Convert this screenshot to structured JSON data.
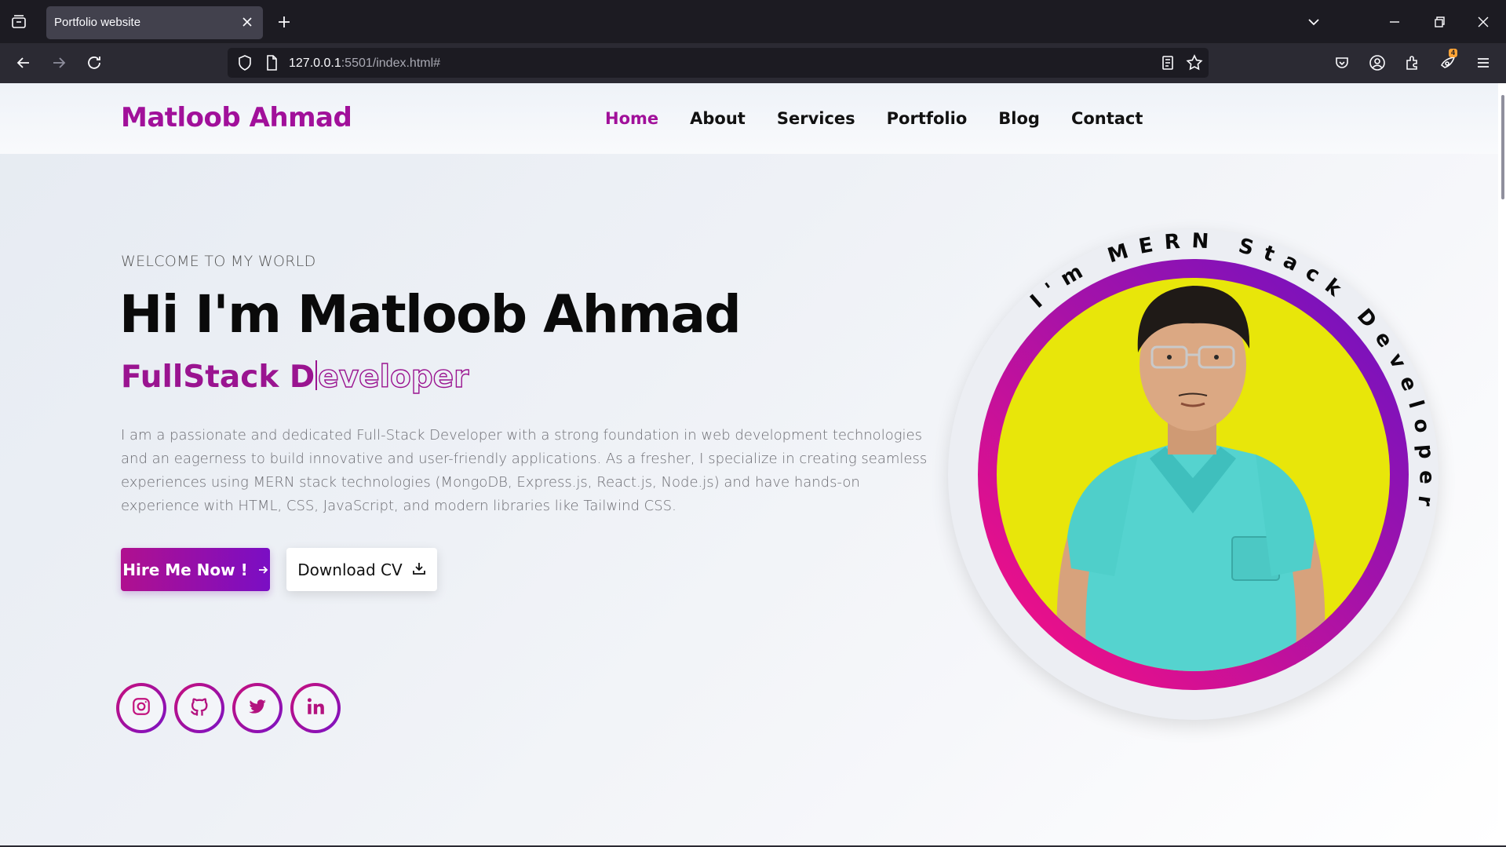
{
  "browser": {
    "tab_title": "Portfolio website",
    "url_host": "127.0.0.1",
    "url_rest": ":5501/index.html#",
    "extension_badge": "4"
  },
  "site": {
    "logo": "Matloob Ahmad",
    "nav": [
      "Home",
      "About",
      "Services",
      "Portfolio",
      "Blog",
      "Contact"
    ],
    "active_nav": "Home"
  },
  "hero": {
    "welcome": "WELCOME TO MY WORLD",
    "title": "Hi I'm Matloob Ahmad",
    "role_solid": "FullStack D",
    "role_outline": "eveloper",
    "bio": "I am a passionate and dedicated Full-Stack Developer with a strong foundation in web development technologies and an eagerness to build innovative and user-friendly applications. As a fresher, I specialize in creating seamless experiences using MERN stack technologies (MongoDB, Express.js, React.js, Node.js) and have hands-on experience with HTML, CSS, JavaScript, and modern libraries like Tailwind CSS.",
    "hire_button": "Hire Me Now !",
    "cv_button": "Download CV",
    "circular_text": "I'm MERN Stack Developer"
  },
  "social": [
    "instagram-icon",
    "github-icon",
    "twitter-icon",
    "linkedin-icon"
  ],
  "colors": {
    "brand": "#a1109a",
    "gradient_start": "#ff0f80",
    "gradient_end": "#6a12c4",
    "photo_bg": "#e8e60a"
  }
}
